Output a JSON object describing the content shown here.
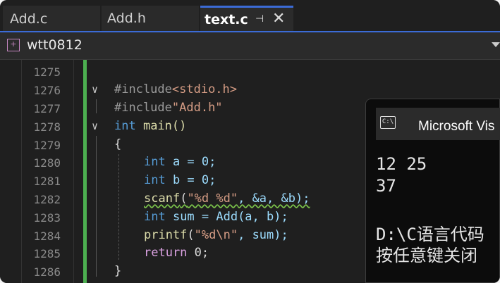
{
  "tabs": [
    {
      "label": "Add.c"
    },
    {
      "label": "Add.h"
    },
    {
      "label": "text.c",
      "active": true
    }
  ],
  "project": {
    "name": "wtt0812"
  },
  "editor": {
    "line_numbers": [
      "1275",
      "1276",
      "1277",
      "1278",
      "1279",
      "1280",
      "1281",
      "1282",
      "1283",
      "1284",
      "1285",
      "1286"
    ],
    "lines": {
      "l1276_a": "#include",
      "l1276_b": "<stdio.h>",
      "l1277_a": "#include",
      "l1277_b": "\"Add.h\"",
      "l1278_kw": "int",
      "l1278_rest": " main()",
      "l1279": "{",
      "l1280_kw": "int",
      "l1280_rest": " a = 0;",
      "l1281_kw": "int",
      "l1281_rest": " b = 0;",
      "l1282_fn": "scanf",
      "l1282_str": "\"%d %d\"",
      "l1282_rest": ", &a, &b);",
      "l1283_kw": "int",
      "l1283_rest": " sum = Add(a, b);",
      "l1284_fn": "printf",
      "l1284_str": "\"%d\\n\"",
      "l1284_rest": ", sum);",
      "l1285_kw": "return",
      "l1285_rest": " 0;",
      "l1286": "}"
    }
  },
  "console": {
    "title": "Microsoft Vis",
    "icon_label": "C:\\",
    "output": [
      "12 25",
      "37",
      "",
      "D:\\C语言代码",
      "按任意键关闭"
    ]
  },
  "colors": {
    "accent": "#3b6bd6",
    "change_bar": "#4caf50"
  }
}
